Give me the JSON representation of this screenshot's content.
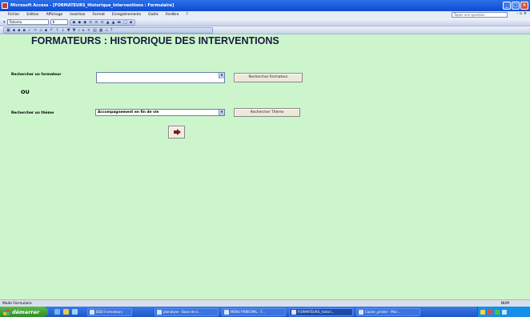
{
  "window": {
    "title": "Microsoft Access - [FORMATEURS_Historique_Interventions : Formulaire]",
    "controls": [
      "_",
      "□",
      "×"
    ]
  },
  "menubar": {
    "items": [
      "Fichier",
      "Edition",
      "Affichage",
      "Insertion",
      "Format",
      "Enregistrements",
      "Outils",
      "Fenêtre",
      "?"
    ],
    "help_placeholder": "Tapez une question",
    "close": "- ▫ ×"
  },
  "toolbar": {
    "font_name": "Tahoma",
    "font_size": "8"
  },
  "form": {
    "title": "FORMATEURS : HISTORIQUE DES INTERVENTIONS",
    "search_formateur_label": "Rechercher un formateur",
    "search_formateur_value": "",
    "search_formateur_button": "Rechercher Formateur",
    "or_label": "OU",
    "search_theme_label": "Rechercher un thème",
    "search_theme_value": "Accompagnement en fin de vie",
    "search_theme_button": "Rechercher Thème"
  },
  "statusbar": {
    "mode": "Mode Formulaire",
    "num": "NUM"
  },
  "taskbar": {
    "start_label": "démarrer",
    "tasks": [
      {
        "label": "BDD Formateurs",
        "active": false
      },
      {
        "label": "planalyse - Base de d...",
        "active": false
      },
      {
        "label": "MENU PRINCIPAL : F...",
        "active": false
      },
      {
        "label": "FORMATEURS_histori...",
        "active": true
      },
      {
        "label": "Copier_pirater - Micr...",
        "active": false
      }
    ],
    "colors": {
      "start": "#3a9a2e",
      "bar": "#245edb",
      "tray": "#1590e8"
    }
  }
}
